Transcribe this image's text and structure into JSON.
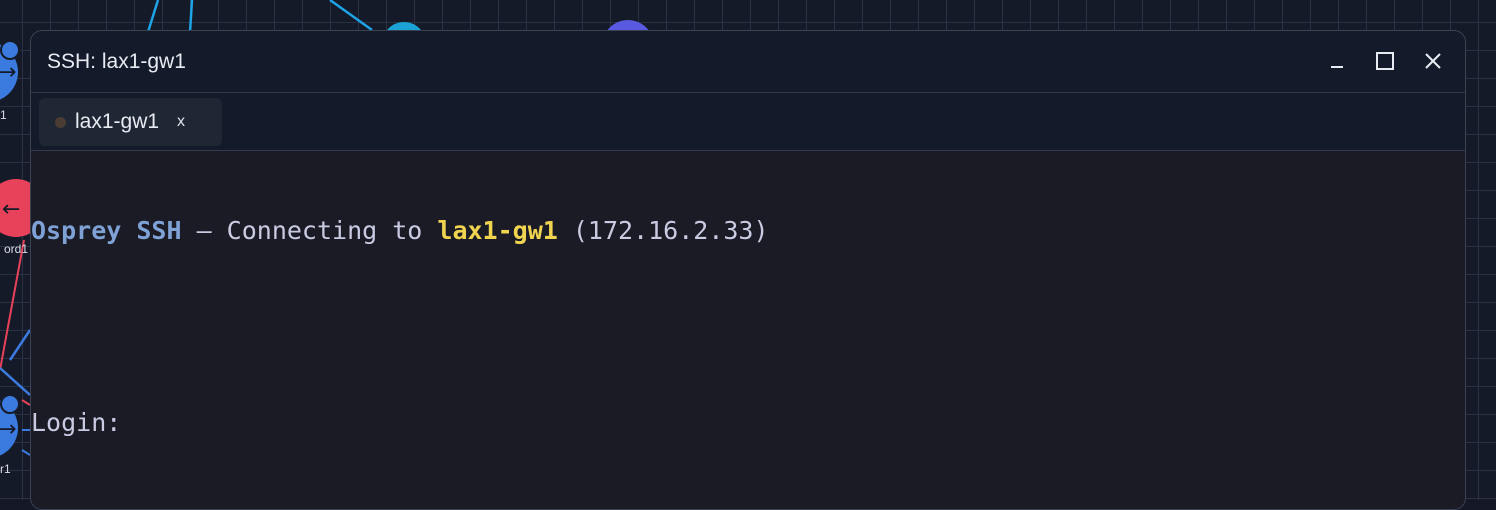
{
  "background": {
    "node_labels": [
      "1",
      "ord1",
      "r1"
    ],
    "colors": {
      "node_blue": "#3b7be0",
      "node_red": "#e8425a",
      "node_cyan": "#1aa3d4",
      "node_indigo": "#5a5ae0",
      "link_cyan": "#1ea3e6",
      "link_red": "#e8425a",
      "link_blue": "#3b7be0"
    }
  },
  "window": {
    "title": "SSH: lax1-gw1",
    "controls": [
      "minimize-icon",
      "maximize-icon",
      "close-icon"
    ]
  },
  "tabs": [
    {
      "label": "lax1-gw1",
      "close": "x",
      "status_color": "#4a3c32"
    }
  ],
  "terminal": {
    "line1": {
      "brand": "Osprey SSH",
      "separator": " — ",
      "text": "Connecting to ",
      "host": "lax1-gw1",
      "ip": " (172.16.2.33)"
    },
    "prompt": "Login:"
  },
  "colors": {
    "window_bg": "#131a2a",
    "terminal_bg": "#1b1b26",
    "brand": "#7ea1d6",
    "host_highlight": "#f0d450",
    "text": "#c9cbe2"
  }
}
